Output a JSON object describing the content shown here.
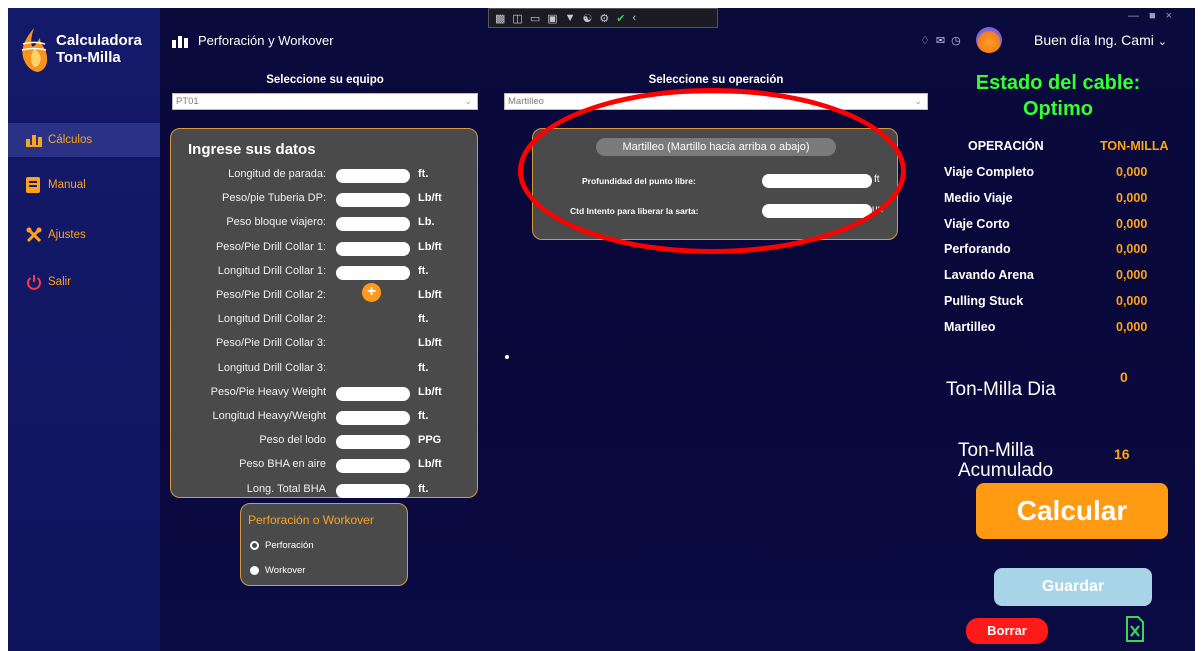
{
  "app": {
    "brand_line1": "Calculadora",
    "brand_line2": "Ton-Milla",
    "title": "Perforación y Workover",
    "greeting": "Buen día Ing. Cami"
  },
  "sidebar": {
    "items": [
      {
        "label": "Cálculos",
        "icon": "chart-icon"
      },
      {
        "label": "Manual",
        "icon": "book-icon"
      },
      {
        "label": "Ajustes",
        "icon": "tools-icon"
      },
      {
        "label": "Salir",
        "icon": "power-icon"
      }
    ]
  },
  "selectors": {
    "equipo_label": "Seleccione su equipo",
    "equipo_value": "PT01",
    "operacion_label": "Seleccione su operación",
    "operacion_value": "Martilleo"
  },
  "datos": {
    "title": "Ingrese sus datos",
    "rows": [
      {
        "label": "Longitud de parada:",
        "unit": "ft."
      },
      {
        "label": "Peso/pie Tuberia DP:",
        "unit": "Lb/ft"
      },
      {
        "label": "Peso bloque viajero:",
        "unit": "Lb."
      },
      {
        "label": "Peso/Pie Drill Collar 1:",
        "unit": "Lb/ft"
      },
      {
        "label": "Longitud Drill Collar 1:",
        "unit": "ft."
      },
      {
        "label": "Peso/Pie Drill Collar 2:",
        "unit": "Lb/ft"
      },
      {
        "label": "Longitud Drill Collar 2:",
        "unit": "ft."
      },
      {
        "label": "Peso/Pie Drill Collar 3:",
        "unit": "Lb/ft"
      },
      {
        "label": "Longitud Drill Collar 3:",
        "unit": "ft."
      },
      {
        "label": "Peso/Pie Heavy Weight",
        "unit": "Lb/ft"
      },
      {
        "label": "Longitud Heavy/Weight",
        "unit": "ft."
      },
      {
        "label": "Peso del lodo",
        "unit": "PPG"
      },
      {
        "label": "Peso BHA en aire",
        "unit": "Lb/ft"
      },
      {
        "label": "Long. Total BHA",
        "unit": "ft."
      }
    ],
    "plus_label": "+"
  },
  "modo": {
    "title": "Perforación o Workover",
    "options": [
      "Perforación",
      "Workover"
    ]
  },
  "operacion_panel": {
    "header": "Martilleo (Martillo hacia arriba o abajo)",
    "rows": [
      {
        "label": "Profundidad del punto libre:",
        "unit": "ft"
      },
      {
        "label": "Ctd Intento para liberar la sarta:",
        "unit": "un"
      }
    ]
  },
  "resultados": {
    "estado_line1": "Estado del cable:",
    "estado_line2": "Optimo",
    "col_operacion": "OPERACIÓN",
    "col_tonmilla": "TON-MILLA",
    "rows": [
      {
        "label": "Viaje Completo",
        "value": "0,000"
      },
      {
        "label": "Medio Viaje",
        "value": "0,000"
      },
      {
        "label": "Viaje Corto",
        "value": "0,000"
      },
      {
        "label": "Perforando",
        "value": "0,000"
      },
      {
        "label": "Lavando Arena",
        "value": "0,000"
      },
      {
        "label": "Pulling Stuck",
        "value": "0,000"
      },
      {
        "label": "Martilleo",
        "value": "0,000"
      }
    ],
    "dia_label": "Ton-Milla Dia",
    "dia_value": "0",
    "acum_label_1": "Ton-Milla",
    "acum_label_2": "Acumulado",
    "acum_value": "16"
  },
  "actions": {
    "calcular": "Calcular",
    "guardar": "Guardar",
    "borrar": "Borrar"
  },
  "colors": {
    "accent": "#ffa31a",
    "ok_status": "#33ff33",
    "annotation": "#ff0000"
  }
}
